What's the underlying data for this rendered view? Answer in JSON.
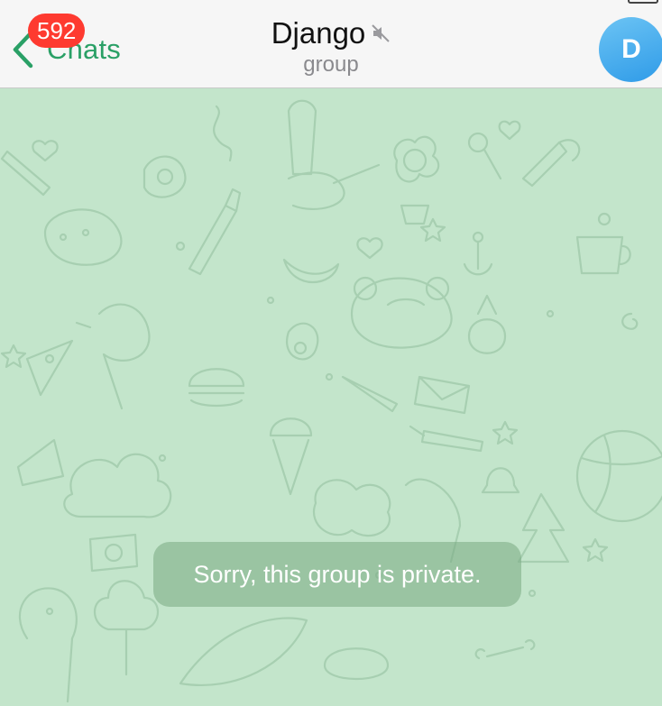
{
  "header": {
    "back_label": "Chats",
    "unread_count": "592",
    "title": "Django",
    "subtitle": "group",
    "avatar_letter": "D"
  },
  "chat": {
    "system_message": "Sorry, this group is private."
  },
  "colors": {
    "accent": "#2aa066",
    "badge": "#fe3a30",
    "chat_background": "#c3e5cb",
    "avatar": "#3aa3ec"
  },
  "icons": {
    "back": "chevron-left-icon",
    "muted": "speaker-muted-icon"
  }
}
